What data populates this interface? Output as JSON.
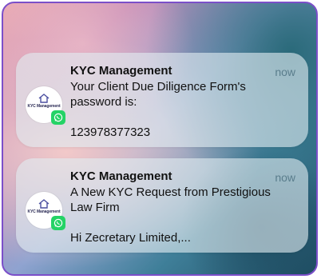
{
  "notifications": [
    {
      "app_name": "KYC Management",
      "logo_text": "KYC Management",
      "time": "now",
      "message": "Your Client Due Diligence Form's\npassword is:\n\n123978377323"
    },
    {
      "app_name": "KYC Management",
      "logo_text": "KYC Management",
      "time": "now",
      "message": "A New KYC Request from Prestigious\nLaw Firm\n\nHi Zecretary Limited,..."
    }
  ],
  "colors": {
    "frame_border": "#7b4fc9",
    "whatsapp_green": "#25d366",
    "time_text": "#5a7d8c"
  },
  "icons": [
    "kyc-logo-icon",
    "whatsapp-icon"
  ]
}
